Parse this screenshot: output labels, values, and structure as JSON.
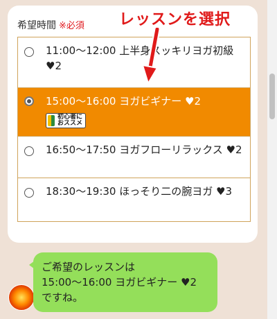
{
  "form": {
    "label": "希望時間",
    "required": "※必須",
    "annotation": "レッスンを選択"
  },
  "options": [
    {
      "text": "11:00〜12:00 上半身スッキリヨガ初級 ♥2",
      "selected": false
    },
    {
      "text": "15:00〜16:00 ヨガビギナー ♥2",
      "selected": true,
      "badge": "初心者に\nおススメ"
    },
    {
      "text": "16:50〜17:50 ヨガフローリラックス ♥2",
      "selected": false
    },
    {
      "text": "18:30〜19:30 ほっそり二の腕ヨガ ♥3",
      "selected": false
    }
  ],
  "chat": {
    "line1": "ご希望のレッスンは",
    "line2": "15:00〜16:00 ヨガビギナー ♥2",
    "line3": "ですね。"
  },
  "colors": {
    "selected": "#f18a00",
    "bubble": "#94df5a",
    "annotation": "#e01a1a"
  }
}
